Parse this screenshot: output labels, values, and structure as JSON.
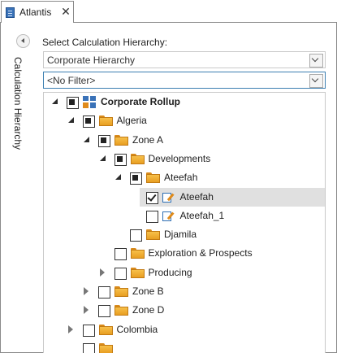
{
  "tab": {
    "title": "Atlantis",
    "close": "✕",
    "icon": "document-grid-icon"
  },
  "sidebar": {
    "vertical_label": "Calculation Hierarchy",
    "collapse_icon": "chevron-left-icon"
  },
  "panel": {
    "select_label": "Select Calculation Hierarchy:",
    "hierarchy_value": "Corporate Hierarchy",
    "filter_value": "<No Filter>"
  },
  "tree": {
    "nodes": [
      {
        "label": "Corporate Rollup",
        "state": "partial",
        "expander": "expanded",
        "icon": "rollup",
        "bold": true
      },
      {
        "label": "Algeria",
        "state": "partial",
        "expander": "expanded",
        "icon": "folder"
      },
      {
        "label": "Zone A",
        "state": "partial",
        "expander": "expanded",
        "icon": "folder"
      },
      {
        "label": "Developments",
        "state": "partial",
        "expander": "expanded",
        "icon": "folder"
      },
      {
        "label": "Ateefah",
        "state": "partial",
        "expander": "expanded",
        "icon": "folder"
      },
      {
        "label": "Ateefah",
        "state": "checked",
        "expander": "none",
        "icon": "document",
        "selected": true
      },
      {
        "label": "Ateefah_1",
        "state": "unchecked",
        "expander": "none",
        "icon": "document"
      },
      {
        "label": "Djamila",
        "state": "unchecked",
        "expander": "none",
        "icon": "folder"
      },
      {
        "label": "Exploration & Prospects",
        "state": "unchecked",
        "expander": "none",
        "icon": "folder"
      },
      {
        "label": "Producing",
        "state": "unchecked",
        "expander": "collapsed",
        "icon": "folder"
      },
      {
        "label": "Zone B",
        "state": "unchecked",
        "expander": "collapsed",
        "icon": "folder"
      },
      {
        "label": "Zone D",
        "state": "unchecked",
        "expander": "collapsed",
        "icon": "folder"
      },
      {
        "label": "Colombia",
        "state": "unchecked",
        "expander": "collapsed",
        "icon": "folder"
      },
      {
        "label": "",
        "state": "unchecked",
        "expander": "none",
        "icon": "folder"
      }
    ]
  }
}
